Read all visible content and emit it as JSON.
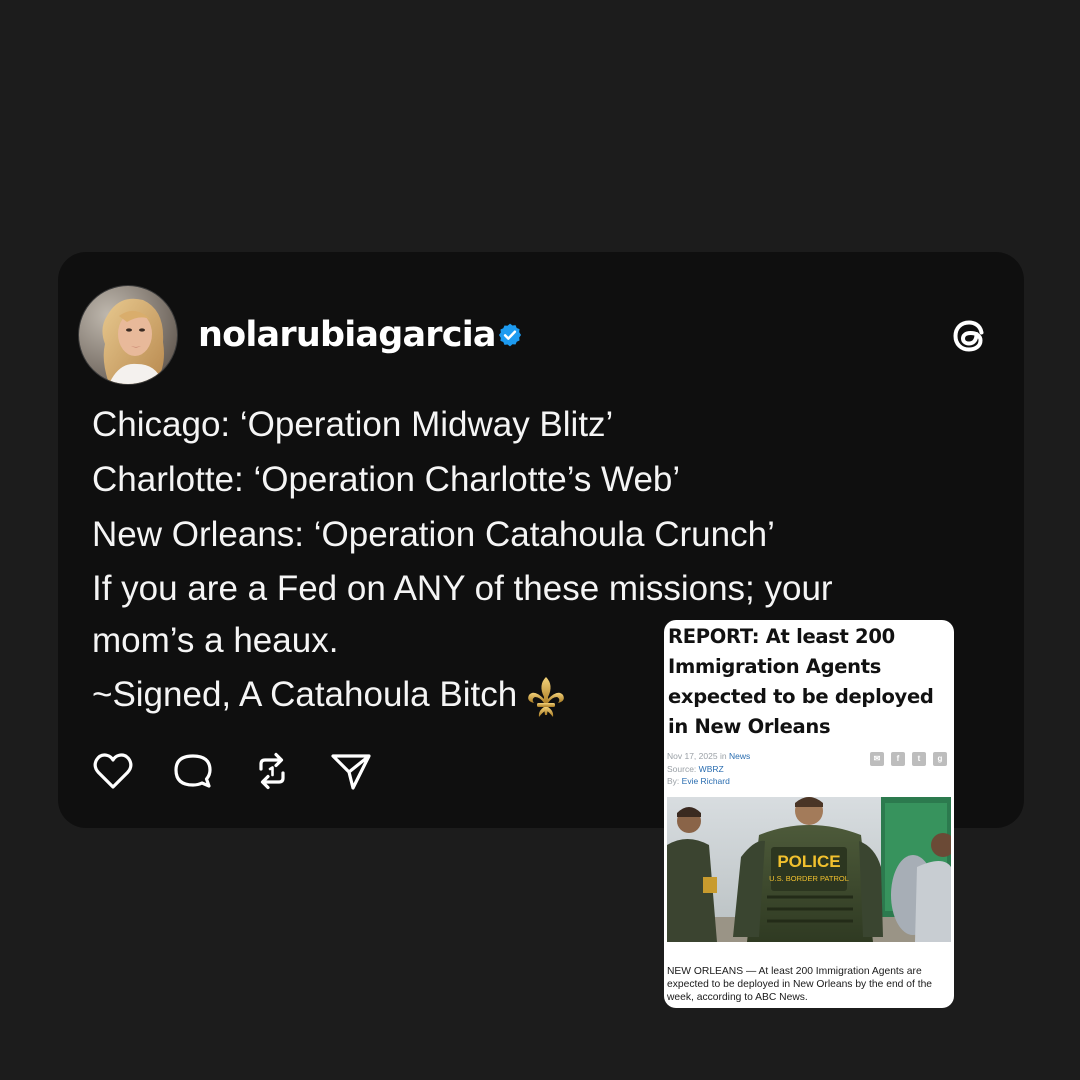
{
  "post": {
    "username": "nolarubiagarcia",
    "lines": [
      "Chicago: ‘Operation Midway Blitz’",
      "Charlotte: ‘Operation Charlotte’s Web’",
      "New Orleans: ‘Operation Catahoula Crunch’",
      "If you are a Fed on ANY of these missions; your",
      "mom’s a heaux.",
      "~Signed, A Catahoula Bitch"
    ],
    "emoji": "fleur-de-lis-icon"
  },
  "icons": {
    "verified": "verified-badge-icon",
    "brand": "threads-logo-icon",
    "actions": [
      "heart-icon",
      "comment-icon",
      "repost-icon",
      "share-icon"
    ]
  },
  "article": {
    "title": "REPORT: At least 200 Immigration Agents expected to be deployed in New Orleans",
    "date": "Nov 17, 2025",
    "in_label": "in",
    "category": "News",
    "source_label": "Source:",
    "source": "WBRZ",
    "by_label": "By:",
    "author": "Evie Richard",
    "photo_badge_line1": "POLICE",
    "photo_badge_line2": "U.S. BORDER PATROL",
    "excerpt": "NEW ORLEANS — At least 200 Immigration Agents are expected to be deployed in New Orleans by the end of the week, according to ABC News."
  },
  "colors": {
    "background": "#1c1c1c",
    "card": "#0f0f0f",
    "verified_blue": "#1d9bf0",
    "text": "#f5f5f5"
  }
}
